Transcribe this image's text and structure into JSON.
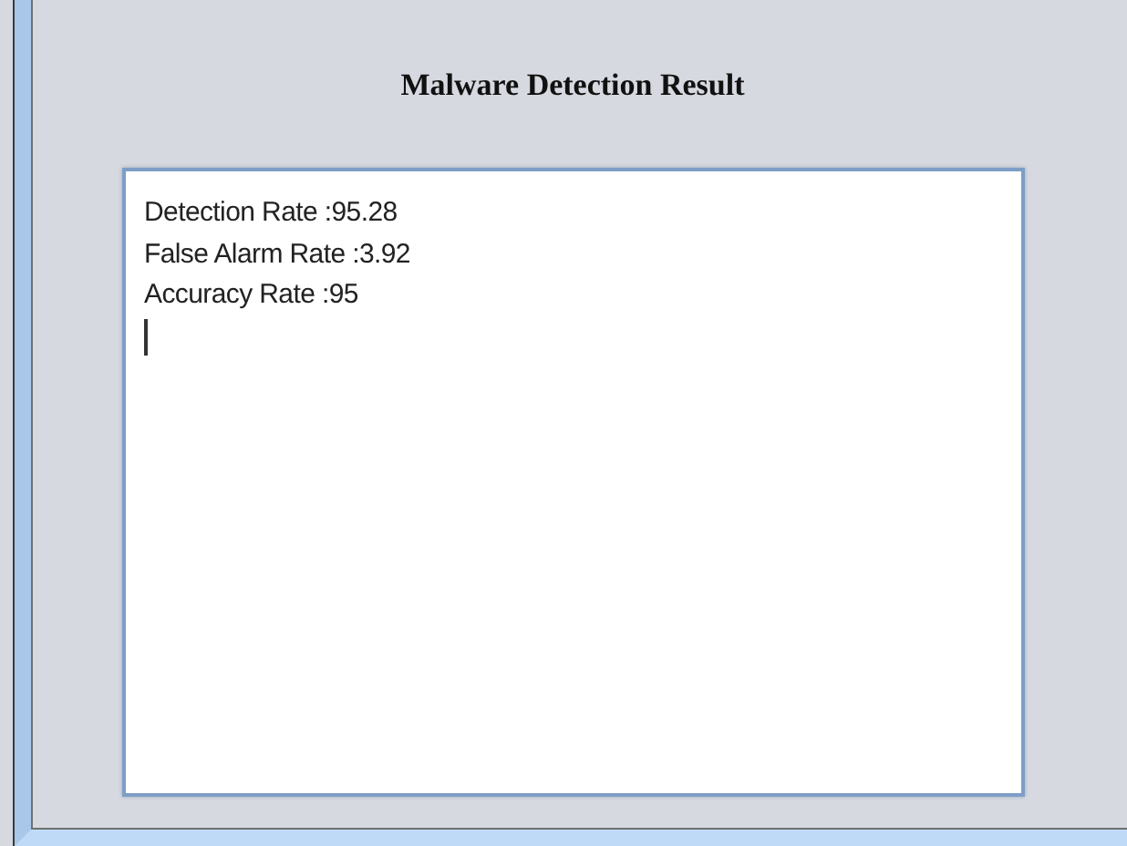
{
  "title": "Malware Detection Result",
  "result_box": {
    "lines": [
      "Detection Rate :95.28",
      "False Alarm Rate :3.92",
      "Accuracy Rate :95"
    ],
    "cursor_visible": true
  }
}
